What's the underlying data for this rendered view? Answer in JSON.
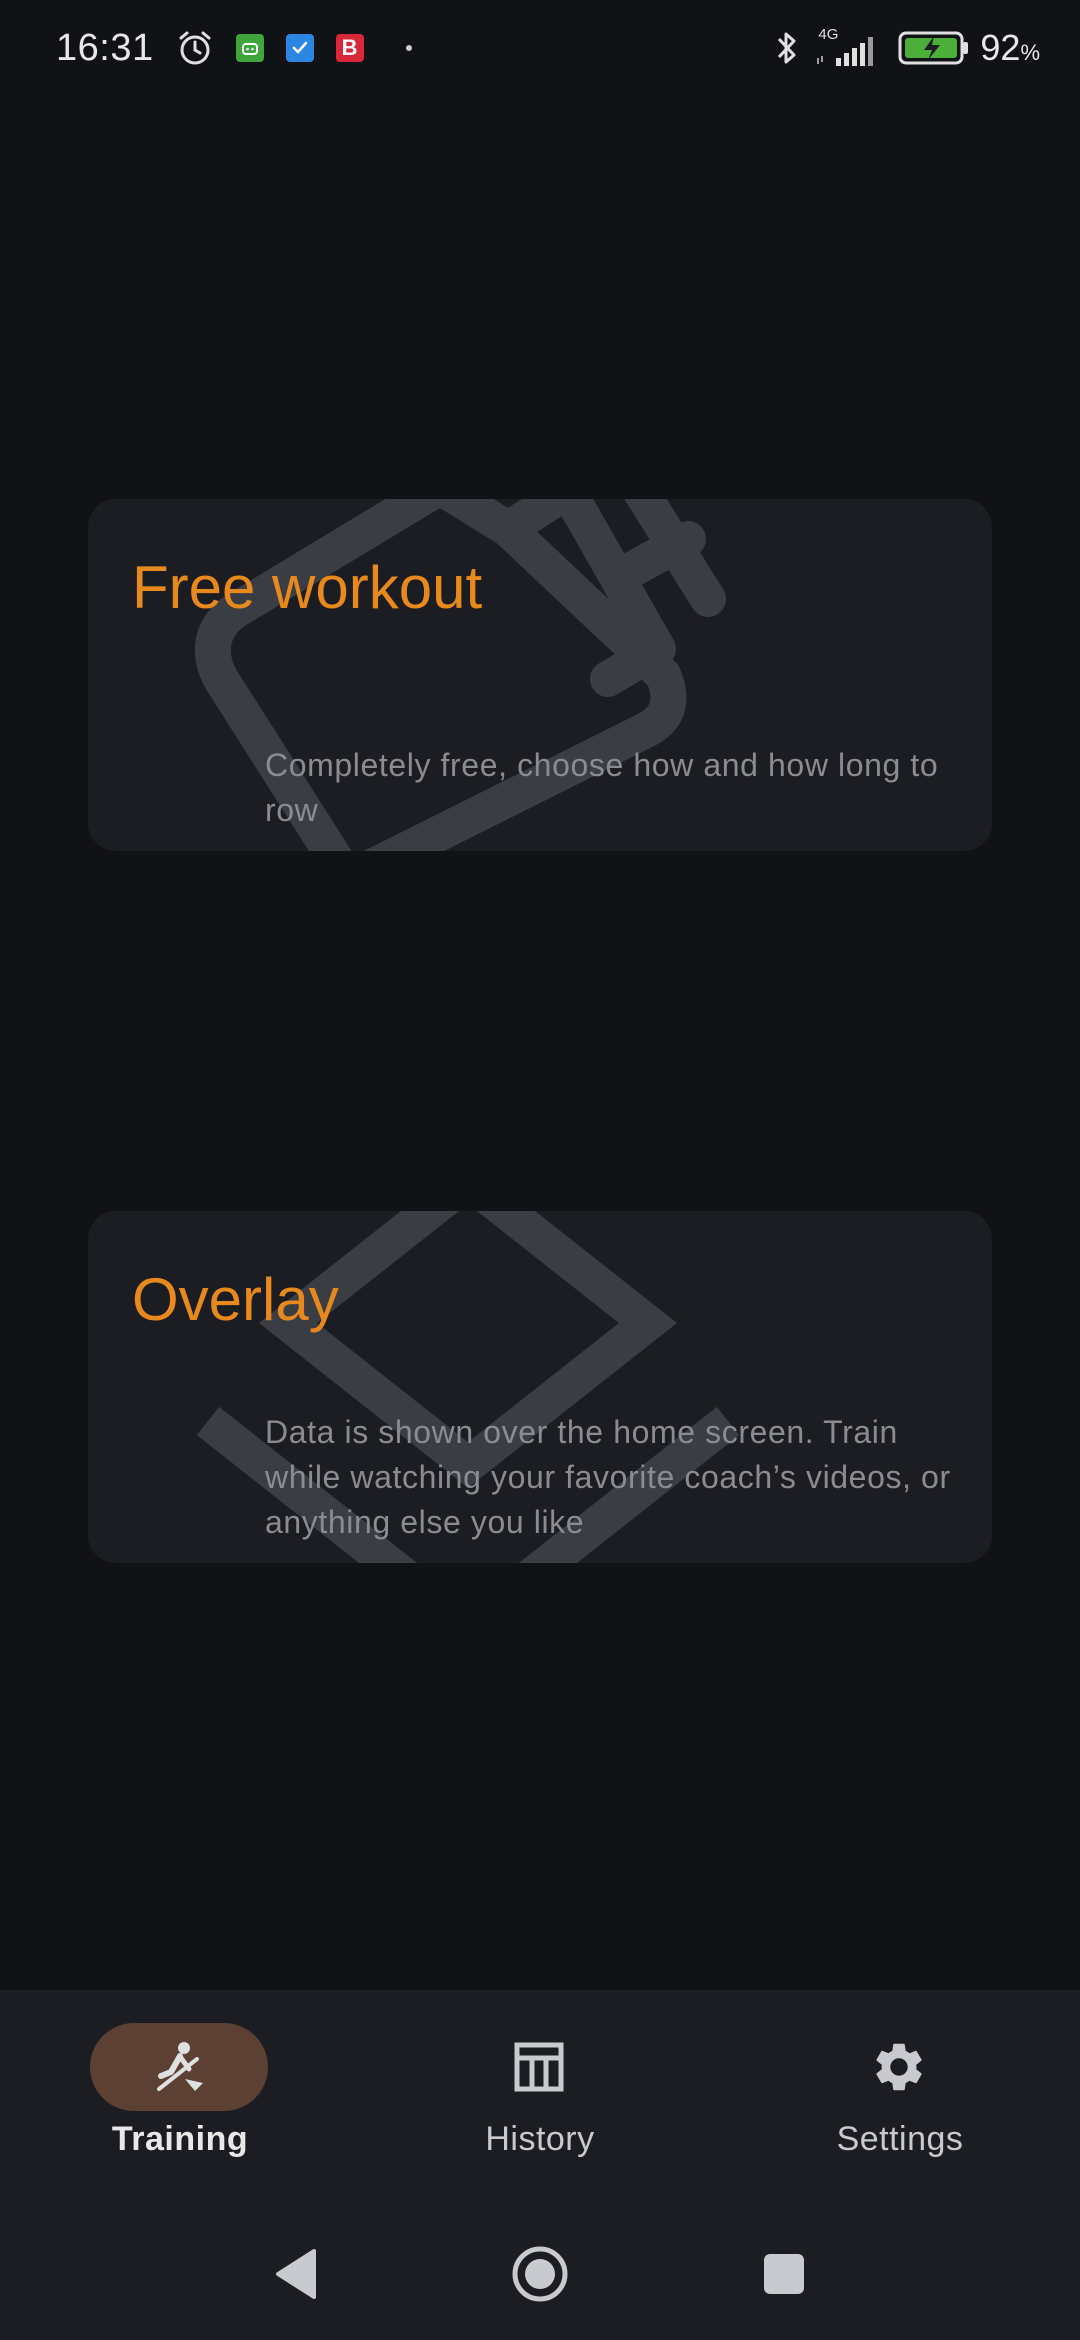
{
  "status_bar": {
    "time": "16:31",
    "battery_percent": "92",
    "battery_unit": "%",
    "network_type": "4G",
    "notification_icons": [
      "alarm-icon",
      "android-app-icon",
      "tasks-app-icon",
      "b-app-icon"
    ],
    "b_app_letter": "B",
    "colors": {
      "android_app": "#3fa53c",
      "tasks_app": "#2a86e0",
      "b_app": "#d8283a",
      "battery_fill": "#4caf3a"
    }
  },
  "cards": [
    {
      "title": "Free workout",
      "description": "Completely free, choose how and how long to row",
      "icon": "water-bottle-icon"
    },
    {
      "title": "Overlay",
      "description": "Data is shown over the home screen. Train while watching your favorite coach’s videos, or anything else you like",
      "icon": "layers-icon"
    }
  ],
  "bottom_nav": {
    "items": [
      {
        "label": "Training",
        "icon": "rowing-icon",
        "active": true
      },
      {
        "label": "History",
        "icon": "table-icon",
        "active": false
      },
      {
        "label": "Settings",
        "icon": "gear-icon",
        "active": false
      }
    ]
  },
  "system_nav": {
    "buttons": [
      "back-icon",
      "home-icon",
      "recents-icon"
    ]
  },
  "theme": {
    "background": "#111216",
    "surface": "#1c1d22",
    "accent": "#e8891d",
    "active_pill": "#5c4034"
  }
}
